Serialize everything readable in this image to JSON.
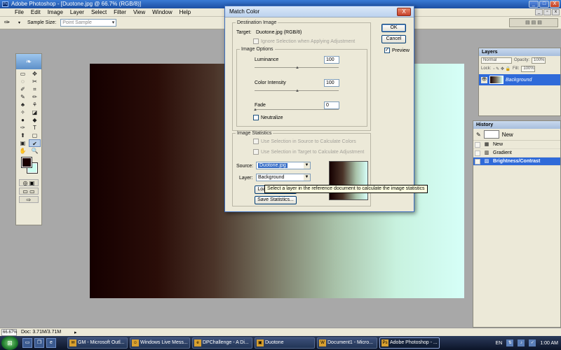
{
  "window": {
    "title": "Adobe Photoshop - [Duotone.jpg @ 66.7% (RGB/8)]",
    "minimize": "_",
    "maximize": "□",
    "close": "X"
  },
  "menu": [
    "File",
    "Edit",
    "Image",
    "Layer",
    "Select",
    "Filter",
    "View",
    "Window",
    "Help"
  ],
  "options_bar": {
    "sample_size_label": "Sample Size:",
    "sample_size_value": "Point Sample"
  },
  "toolbox": {
    "tools": [
      "▭",
      "✥",
      "◌",
      "✂",
      "✐",
      "⌗",
      "✎",
      "✏",
      "♣",
      "⚘",
      "✧",
      "◪",
      "●",
      "◆",
      "✑",
      "T",
      "⬆",
      "▢",
      "▣",
      "✔",
      "✋",
      "🔍"
    ]
  },
  "layers_panel": {
    "tab": "Layers",
    "blend_mode": "Normal",
    "opacity_label": "Opacity:",
    "opacity_value": "100%",
    "lock_label": "Lock:",
    "fill_label": "Fill:",
    "fill_value": "100%",
    "layer_name": "Background"
  },
  "history_panel": {
    "tab": "History",
    "snapshot": "New",
    "items": [
      {
        "label": "New",
        "icon": "▦"
      },
      {
        "label": "Gradient",
        "icon": "▥"
      },
      {
        "label": "Brightness/Contrast",
        "icon": "▨"
      }
    ]
  },
  "dialog": {
    "title": "Match Color",
    "close": "X",
    "destination_legend": "Destination Image",
    "target_label": "Target:",
    "target_value": "Duotone.jpg (RGB/8)",
    "ignore_selection": "Ignore Selection when Applying Adjustment",
    "image_options_legend": "Image Options",
    "luminance_label": "Luminance",
    "luminance_value": "100",
    "color_intensity_label": "Color Intensity",
    "color_intensity_value": "100",
    "fade_label": "Fade",
    "fade_value": "0",
    "neutralize_label": "Neutralize",
    "statistics_legend": "Image Statistics",
    "use_selection_source": "Use Selection in Source to Calculate Colors",
    "use_selection_target": "Use Selection in Target to Calculate Adjustment",
    "source_label": "Source:",
    "source_value": "Duotone.jpg",
    "layer_label": "Layer:",
    "layer_value": "Background",
    "load_stats": "Load Statistics...",
    "save_stats": "Save Statistics...",
    "ok": "OK",
    "cancel": "Cancel",
    "preview_label": "Preview",
    "tooltip": "Select a layer in the reference document to calculate the image statistics"
  },
  "status_bar": {
    "zoom": "66.67%",
    "doc_size": "Doc: 3.71M/3.71M"
  },
  "taskbar": {
    "tasks": [
      {
        "label": "GM - Microsoft Outl...",
        "icon": "✉"
      },
      {
        "label": "Windows Live Mess...",
        "icon": "☺"
      },
      {
        "label": "DPChallenge - A Di...",
        "icon": "e"
      },
      {
        "label": "Duotone",
        "icon": "▣"
      },
      {
        "label": "Document1 - Micro...",
        "icon": "W"
      },
      {
        "label": "Adobe Photoshop - ...",
        "icon": "Ps"
      }
    ],
    "lang": "EN",
    "clock": "1:00 AM"
  }
}
